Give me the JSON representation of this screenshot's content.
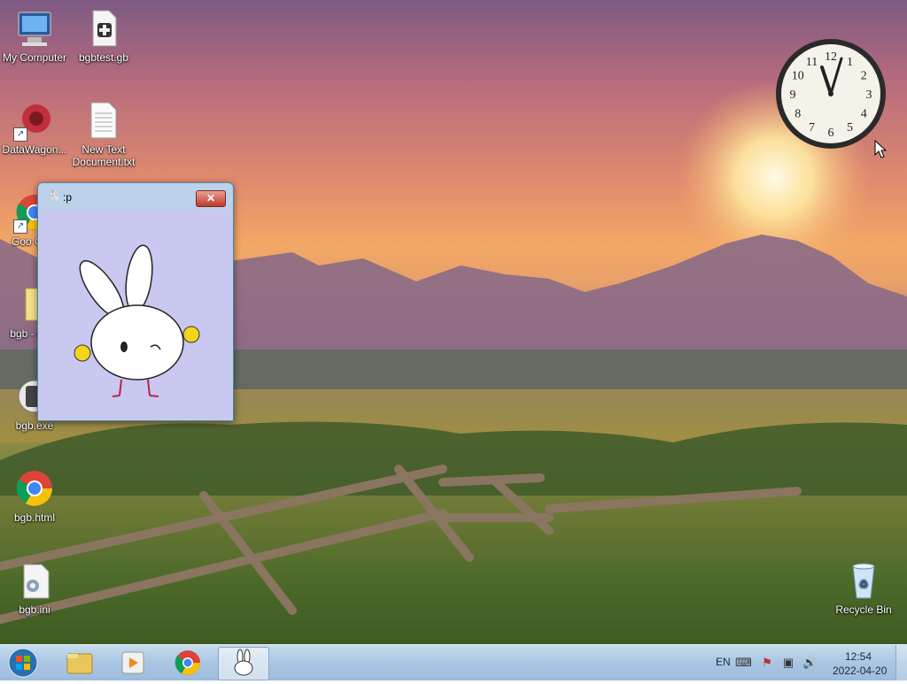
{
  "desktop": {
    "icons": [
      {
        "label": "My Computer"
      },
      {
        "label": "bgbtest.gb"
      },
      {
        "label": "DataWagon..."
      },
      {
        "label": "New Text Document.txt"
      },
      {
        "label": "Goo Chro"
      },
      {
        "label": "bgb - (25)."
      },
      {
        "label": "bgb.exe"
      },
      {
        "label": "bgb.html"
      },
      {
        "label": "bgb.ini"
      },
      {
        "label": "Recycle Bin"
      }
    ]
  },
  "window": {
    "title": ":p",
    "close_label": "✕"
  },
  "clock": {
    "numerals": [
      "12",
      "1",
      "2",
      "3",
      "4",
      "5",
      "6",
      "7",
      "8",
      "9",
      "10",
      "11"
    ]
  },
  "taskbar": {
    "language": "EN",
    "time": "12:54",
    "date": "2022-04-20"
  }
}
